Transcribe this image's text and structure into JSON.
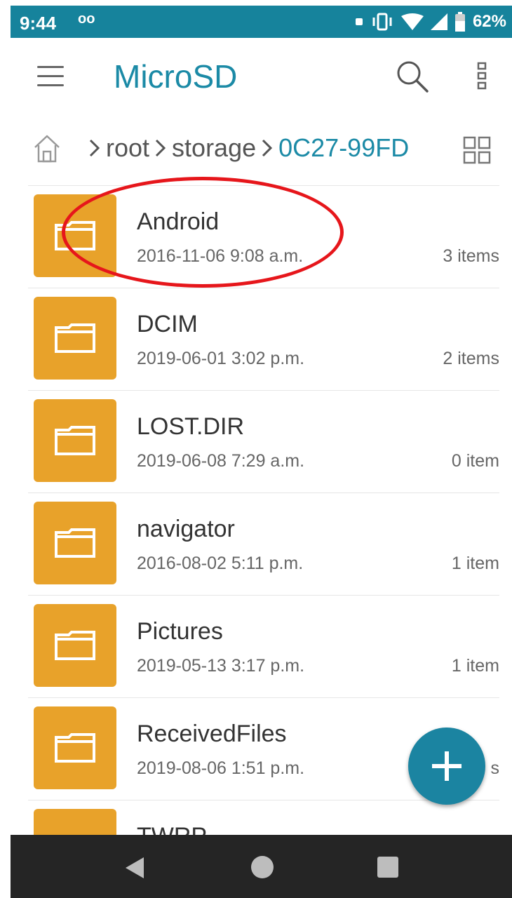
{
  "status_bar": {
    "time": "9:44",
    "voicemail": "oo",
    "battery_percent": "62%"
  },
  "app_bar": {
    "title": "MicroSD"
  },
  "breadcrumb": {
    "items": [
      "root",
      "storage",
      "0C27-99FD"
    ]
  },
  "folders": [
    {
      "name": "Android",
      "date": "2016-11-06 9:08 a.m.",
      "count": "3 items"
    },
    {
      "name": "DCIM",
      "date": "2019-06-01 3:02 p.m.",
      "count": "2 items"
    },
    {
      "name": "LOST.DIR",
      "date": "2019-06-08 7:29 a.m.",
      "count": "0 item"
    },
    {
      "name": "navigator",
      "date": "2016-08-02 5:11 p.m.",
      "count": "1 item"
    },
    {
      "name": "Pictures",
      "date": "2019-05-13 3:17 p.m.",
      "count": "1 item"
    },
    {
      "name": "ReceivedFiles",
      "date": "2019-08-06 1:51 p.m.",
      "count": "s"
    },
    {
      "name": "TWRP",
      "date": "",
      "count": ""
    }
  ],
  "colors": {
    "accent": "#1b8aa6",
    "status_bar": "#16839c",
    "folder": "#e8a22a",
    "highlight": "#e6161b",
    "nav_bar": "#252525"
  },
  "icons": [
    "menu-icon",
    "search-icon",
    "more-vert-icon",
    "home-icon",
    "grid-view-icon",
    "folder-icon",
    "add-icon",
    "back-icon",
    "home-nav-icon",
    "recents-icon"
  ]
}
